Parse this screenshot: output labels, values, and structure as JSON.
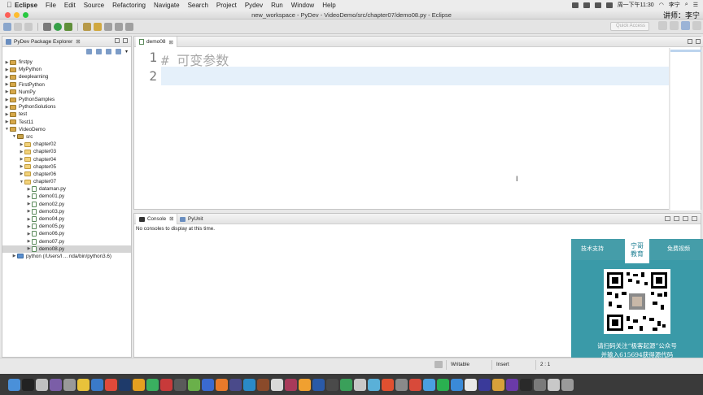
{
  "menubar": {
    "app": "Eclipse",
    "items": [
      "File",
      "Edit",
      "Source",
      "Refactoring",
      "Navigate",
      "Search",
      "Project",
      "Pydev",
      "Run",
      "Window",
      "Help"
    ],
    "clock": "周一下午11:30",
    "user": "李宁"
  },
  "window": {
    "title": "new_workspace - PyDev - VideoDemo/src/chapter07/demo08.py - Eclipse",
    "lecturer": "讲师：李宁"
  },
  "toolbar": {
    "quick_access_placeholder": "Quick Access"
  },
  "explorer": {
    "title": "PyDev Package Explorer",
    "close": "⊠",
    "projects": [
      {
        "label": "firstpy",
        "expanded": false
      },
      {
        "label": "MyPython",
        "expanded": false
      },
      {
        "label": "deeplearning",
        "expanded": false
      },
      {
        "label": "FirstPython",
        "expanded": false
      },
      {
        "label": "NumPy",
        "expanded": false
      },
      {
        "label": "PythonSamples",
        "expanded": false
      },
      {
        "label": "PythonSolutions",
        "expanded": false
      },
      {
        "label": "test",
        "expanded": false
      },
      {
        "label": "Test11",
        "expanded": false
      },
      {
        "label": "VideoDemo",
        "expanded": true
      }
    ],
    "src": "src",
    "folders": [
      "chapter02",
      "chapter03",
      "chapter04",
      "chapter05",
      "chapter06"
    ],
    "chapter07": "chapter07",
    "files": [
      "dataman.py",
      "demo01.py",
      "demo02.py",
      "demo03.py",
      "demo04.py",
      "demo05.py",
      "demo06.py",
      "demo07.py",
      "demo08.py"
    ],
    "selected_file": "demo08.py",
    "interpreter": "python  (/Users/l ... nda/bin/python3.6)"
  },
  "editor": {
    "tab": "demo08",
    "lines": [
      {
        "num": "1",
        "text": "#  可变参数"
      },
      {
        "num": "2",
        "text": ""
      }
    ]
  },
  "console": {
    "tabs": [
      "Console",
      "PyUnit"
    ],
    "message": "No consoles to display at this time."
  },
  "status": {
    "mode": "Writable",
    "insert": "Insert",
    "position": "2 : 1"
  },
  "promo": {
    "left": "技术支持",
    "logo_line1": "宁哥",
    "logo_line2": "教育",
    "right": "免费视频",
    "caption_line1": "请扫码关注“极客起源”公众号",
    "caption_line2": "并输入615694获得源代码"
  },
  "colors": {
    "current_line": "#e5f0fa",
    "promo_bg": "#3a9aa8",
    "selection": "#d5d5d5"
  }
}
